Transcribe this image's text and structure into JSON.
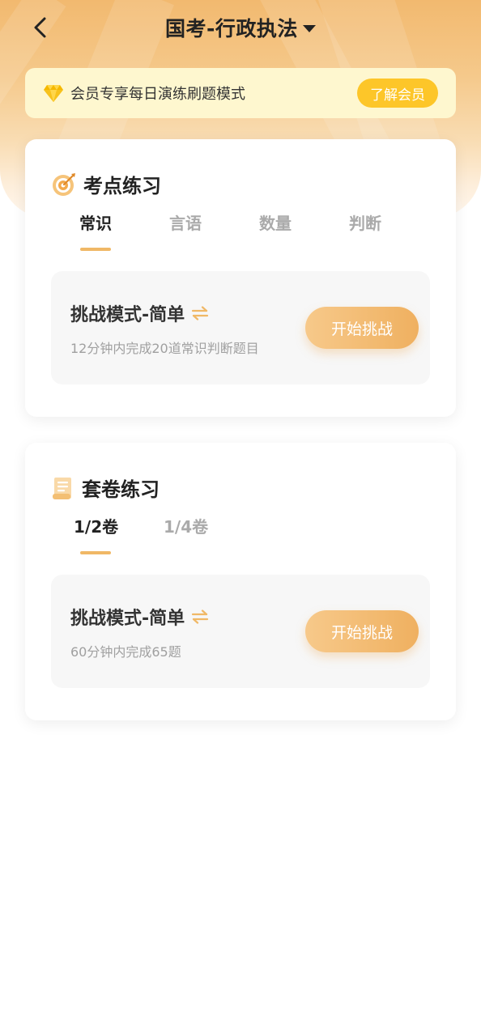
{
  "header": {
    "title": "国考-行政执法",
    "back_icon": "chevron-left-icon",
    "dropdown_icon": "caret-down-icon"
  },
  "vip_banner": {
    "text": "会员专享每日演练刷题模式",
    "button_label": "了解会员",
    "icon": "diamond-icon",
    "button_color": "#fdc629",
    "background_color": "#fef7cf"
  },
  "topic_practice": {
    "title": "考点练习",
    "icon": "target-icon",
    "tabs": [
      {
        "label": "常识",
        "active": true
      },
      {
        "label": "言语",
        "active": false
      },
      {
        "label": "数量",
        "active": false
      },
      {
        "label": "判断",
        "active": false
      }
    ],
    "challenge": {
      "title": "挑战模式-简单",
      "description": "12分钟内完成20道常识判断题目",
      "button_label": "开始挑战",
      "swap_icon": "swap-arrows-icon"
    }
  },
  "paper_practice": {
    "title": "套卷练习",
    "icon": "document-icon",
    "tabs": [
      {
        "label": "1/2卷",
        "active": true
      },
      {
        "label": "1/4卷",
        "active": false
      }
    ],
    "challenge": {
      "title": "挑战模式-简单",
      "description": "60分钟内完成65题",
      "button_label": "开始挑战",
      "swap_icon": "swap-arrows-icon"
    }
  },
  "colors": {
    "accent": "#f0b866",
    "hero_gradient_top": "#f2b96f"
  }
}
